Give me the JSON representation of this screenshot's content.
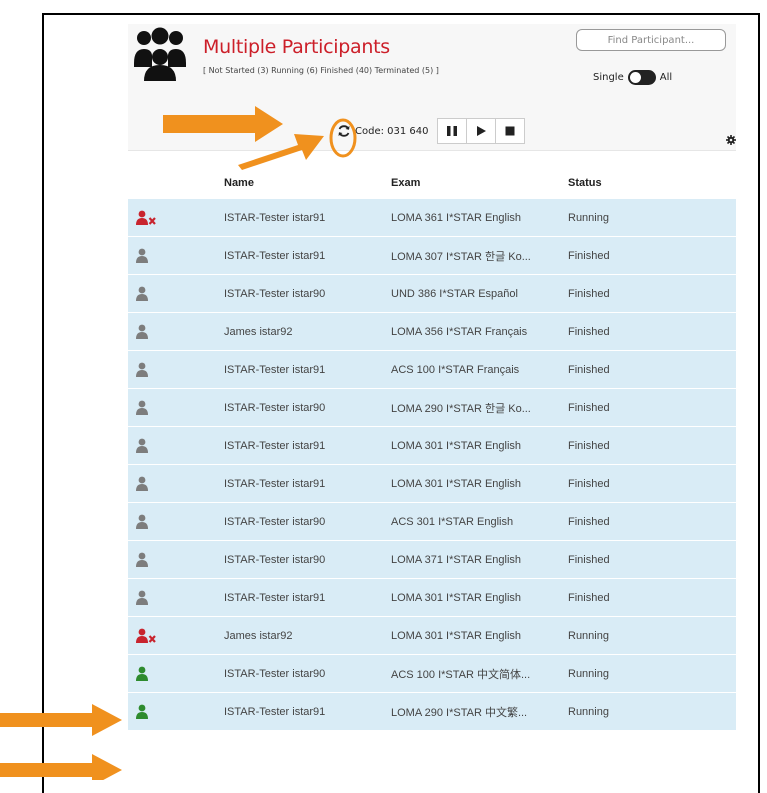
{
  "header": {
    "title": "Multiple Participants",
    "summary": "[ Not Started (3) Running (6) Finished (40) Terminated (5) ]",
    "find_placeholder": "Find Participant...",
    "toggle_single": "Single",
    "toggle_all": "All",
    "code_label": "Code: 031 640"
  },
  "table": {
    "columns": [
      "Name",
      "Exam",
      "Status"
    ],
    "rows": [
      {
        "name": "ISTAR-Tester istar91",
        "exam": "LOMA 361 I*STAR English",
        "status": "Running",
        "icon": "user-remove-icon",
        "icon_color": "#c8242e"
      },
      {
        "name": "ISTAR-Tester istar91",
        "exam": "LOMA 307 I*STAR 한글 Ko...",
        "status": "Finished",
        "icon": "user-icon",
        "icon_color": "#7d7d7d"
      },
      {
        "name": "ISTAR-Tester istar90",
        "exam": "UND 386 I*STAR Español",
        "status": "Finished",
        "icon": "user-icon",
        "icon_color": "#7d7d7d"
      },
      {
        "name": "James istar92",
        "exam": "LOMA 356 I*STAR Français",
        "status": "Finished",
        "icon": "user-icon",
        "icon_color": "#7d7d7d"
      },
      {
        "name": "ISTAR-Tester istar91",
        "exam": "ACS 100 I*STAR Français",
        "status": "Finished",
        "icon": "user-icon",
        "icon_color": "#7d7d7d"
      },
      {
        "name": "ISTAR-Tester istar90",
        "exam": "LOMA 290 I*STAR 한글 Ko...",
        "status": "Finished",
        "icon": "user-icon",
        "icon_color": "#7d7d7d"
      },
      {
        "name": "ISTAR-Tester istar91",
        "exam": "LOMA 301 I*STAR English",
        "status": "Finished",
        "icon": "user-icon",
        "icon_color": "#7d7d7d"
      },
      {
        "name": "ISTAR-Tester istar91",
        "exam": "LOMA 301 I*STAR English",
        "status": "Finished",
        "icon": "user-icon",
        "icon_color": "#7d7d7d"
      },
      {
        "name": "ISTAR-Tester istar90",
        "exam": "ACS 301 I*STAR English",
        "status": "Finished",
        "icon": "user-icon",
        "icon_color": "#7d7d7d"
      },
      {
        "name": "ISTAR-Tester istar90",
        "exam": "LOMA 371 I*STAR English",
        "status": "Finished",
        "icon": "user-icon",
        "icon_color": "#7d7d7d"
      },
      {
        "name": "ISTAR-Tester istar91",
        "exam": "LOMA 301 I*STAR English",
        "status": "Finished",
        "icon": "user-icon",
        "icon_color": "#7d7d7d"
      },
      {
        "name": "James istar92",
        "exam": "LOMA 301 I*STAR English",
        "status": "Running",
        "icon": "user-remove-icon",
        "icon_color": "#c8242e"
      },
      {
        "name": "ISTAR-Tester istar90",
        "exam": "ACS 100 I*STAR 中文简体...",
        "status": "Running",
        "icon": "user-icon",
        "icon_color": "#2e8b2e"
      },
      {
        "name": "ISTAR-Tester istar91",
        "exam": "LOMA 290 I*STAR 中文繁...",
        "status": "Running",
        "icon": "user-icon",
        "icon_color": "#2e8b2e"
      }
    ]
  },
  "colors": {
    "title_red": "#cc1f29",
    "row_bg": "#d9ecf6",
    "annotation_orange": "#f0911e"
  }
}
